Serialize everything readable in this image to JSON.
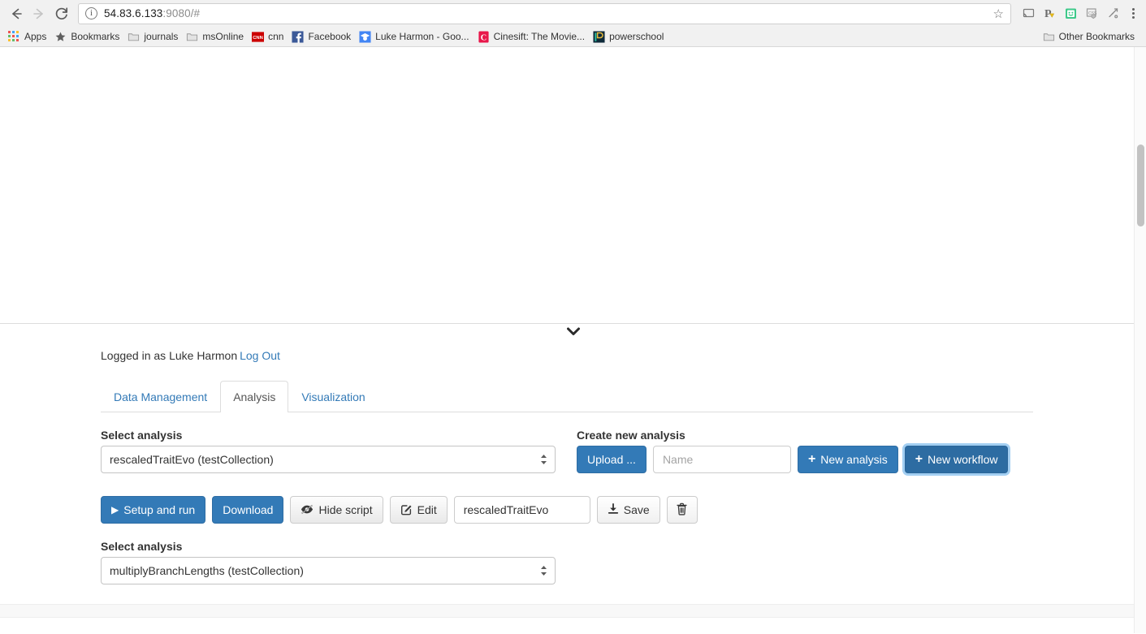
{
  "browser": {
    "nav": {
      "back_label": "←",
      "forward_label": "→",
      "reload_label": "⟳"
    },
    "omnibox": {
      "info_glyph": "i",
      "url_host": "54.83.6.133",
      "url_rest": ":9080/#",
      "star_glyph": "☆"
    },
    "extensions": [
      {
        "name": "cast-icon"
      },
      {
        "name": "lastpass-icon"
      },
      {
        "name": "smiley-extension-icon"
      },
      {
        "name": "css-shield-icon"
      },
      {
        "name": "pin-tool-icon"
      }
    ],
    "bookmarks": [
      {
        "label": "Apps",
        "icon": "apps-grid-icon"
      },
      {
        "label": "Bookmarks",
        "icon": "star-icon"
      },
      {
        "label": "journals",
        "icon": "folder-icon"
      },
      {
        "label": "msOnline",
        "icon": "folder-icon"
      },
      {
        "label": "cnn",
        "icon": "cnn-favicon"
      },
      {
        "label": "Facebook",
        "icon": "facebook-favicon"
      },
      {
        "label": "Luke Harmon - Goo...",
        "icon": "google-scholar-favicon"
      },
      {
        "label": "Cinesift: The Movie...",
        "icon": "cinesift-favicon"
      },
      {
        "label": "powerschool",
        "icon": "powerschool-favicon"
      }
    ],
    "other_bookmarks": {
      "label": "Other Bookmarks",
      "icon": "folder-icon"
    }
  },
  "panel": {
    "collapse_caret": "❯",
    "login": {
      "text": "Logged in as Luke Harmon",
      "logout_label": "Log Out"
    },
    "tabs": [
      {
        "label": "Data Management",
        "active": false
      },
      {
        "label": "Analysis",
        "active": true
      },
      {
        "label": "Visualization",
        "active": false
      }
    ],
    "select_analysis": {
      "label": "Select analysis",
      "value": "rescaledTraitEvo (testCollection)"
    },
    "create_new_analysis": {
      "label": "Create new analysis",
      "upload_label": "Upload ...",
      "name_placeholder": "Name",
      "name_value": "",
      "new_analysis_label": "New analysis",
      "new_workflow_label": "New workflow",
      "plus_glyph": "+"
    },
    "actions": {
      "setup_and_run_label": "Setup and run",
      "play_glyph": "▶",
      "download_label": "Download",
      "hide_script_label": "Hide script",
      "hide_script_icon": "eye-slash-icon",
      "edit_label": "Edit",
      "edit_icon": "pencil-square-icon",
      "script_name_value": "rescaledTraitEvo",
      "save_label": "Save",
      "save_icon": "download-arrow-icon",
      "delete_icon": "trash-icon"
    },
    "select_analysis_2": {
      "label": "Select analysis",
      "value": "multiplyBranchLengths (testCollection)"
    }
  },
  "colors": {
    "primary": "#337ab7",
    "link": "#337ab7",
    "chrome_bg": "#f1f1f1",
    "border": "#dddddd"
  }
}
